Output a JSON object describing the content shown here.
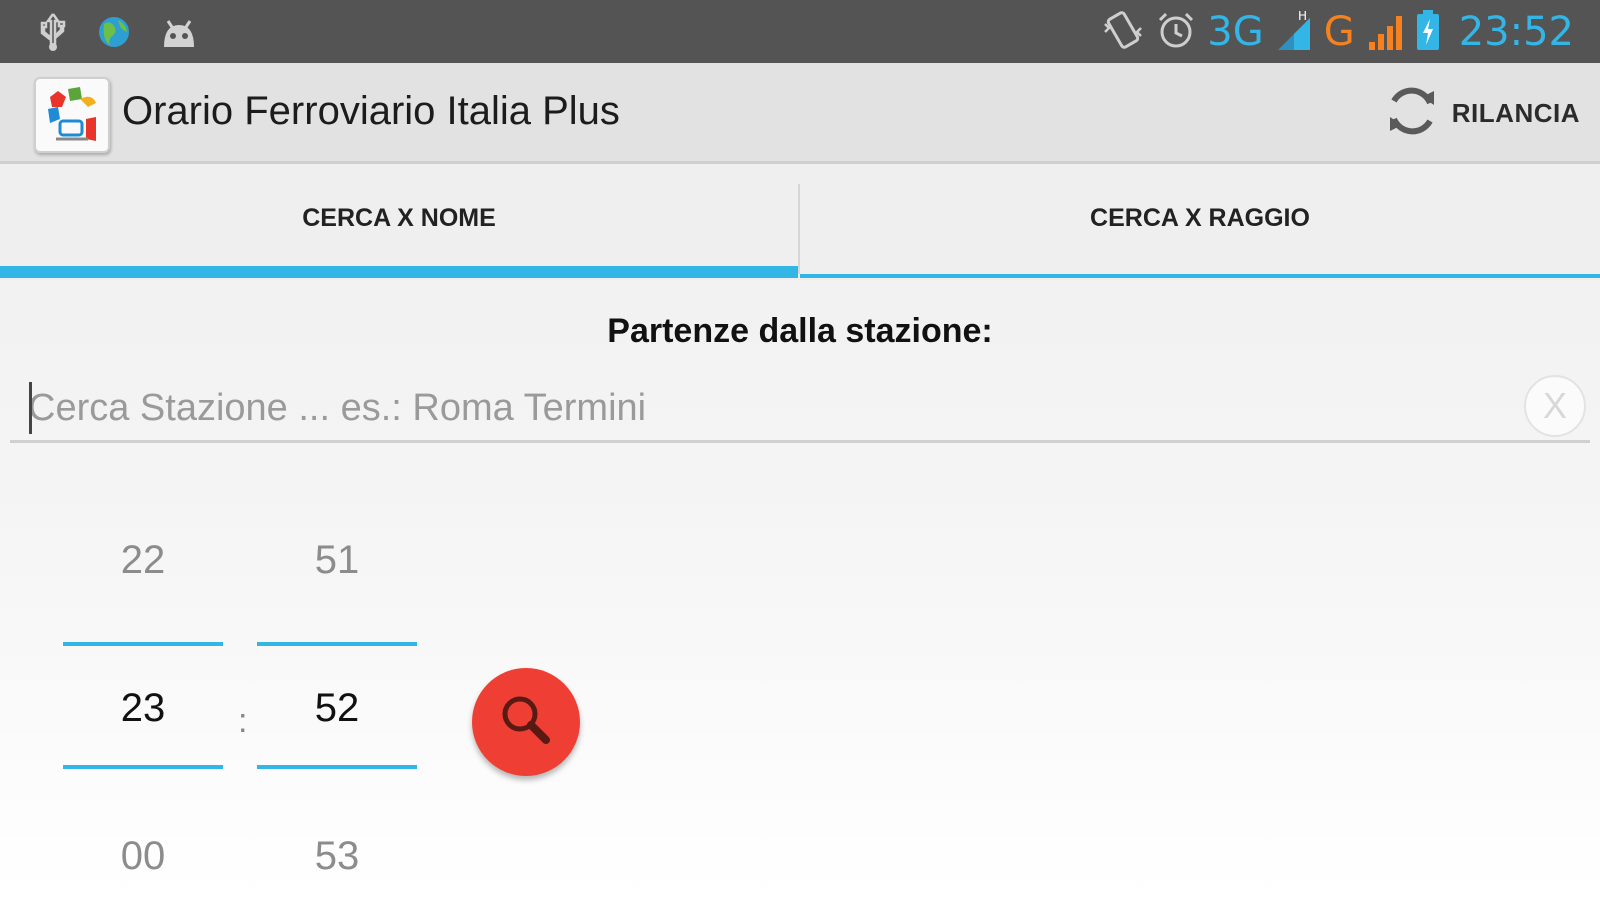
{
  "status_bar": {
    "icons_left": [
      "usb-icon",
      "globe-icon",
      "android-icon"
    ],
    "icons_right": [
      "vibrate-icon",
      "alarm-icon",
      "signal-icon",
      "battery-charging-icon"
    ],
    "network_primary": "3G",
    "network_secondary": "G",
    "clock": "23:52",
    "colors": {
      "background": "#545454",
      "accent": "#33b5e5",
      "secondary": "#f5821f"
    }
  },
  "action_bar": {
    "app_title": "Orario Ferroviario Italia Plus",
    "app_icon": "app-logo-icon",
    "reload_label": "RILANCIA",
    "reload_icon": "refresh-icon"
  },
  "tabs": [
    {
      "label": "CERCA X NOME",
      "selected": true
    },
    {
      "label": "CERCA X RAGGIO",
      "selected": false
    }
  ],
  "search": {
    "section_title": "Partenze dalla stazione:",
    "placeholder": "Cerca Stazione ... es.: Roma Termini",
    "value": "",
    "clear_label": "X"
  },
  "time_picker": {
    "hours": {
      "prev": "22",
      "current": "23",
      "next": "00"
    },
    "minutes": {
      "prev": "51",
      "current": "52",
      "next": "53"
    },
    "separator": ":"
  },
  "search_button": {
    "icon": "magnifier-icon",
    "color": "#ef3f35"
  }
}
